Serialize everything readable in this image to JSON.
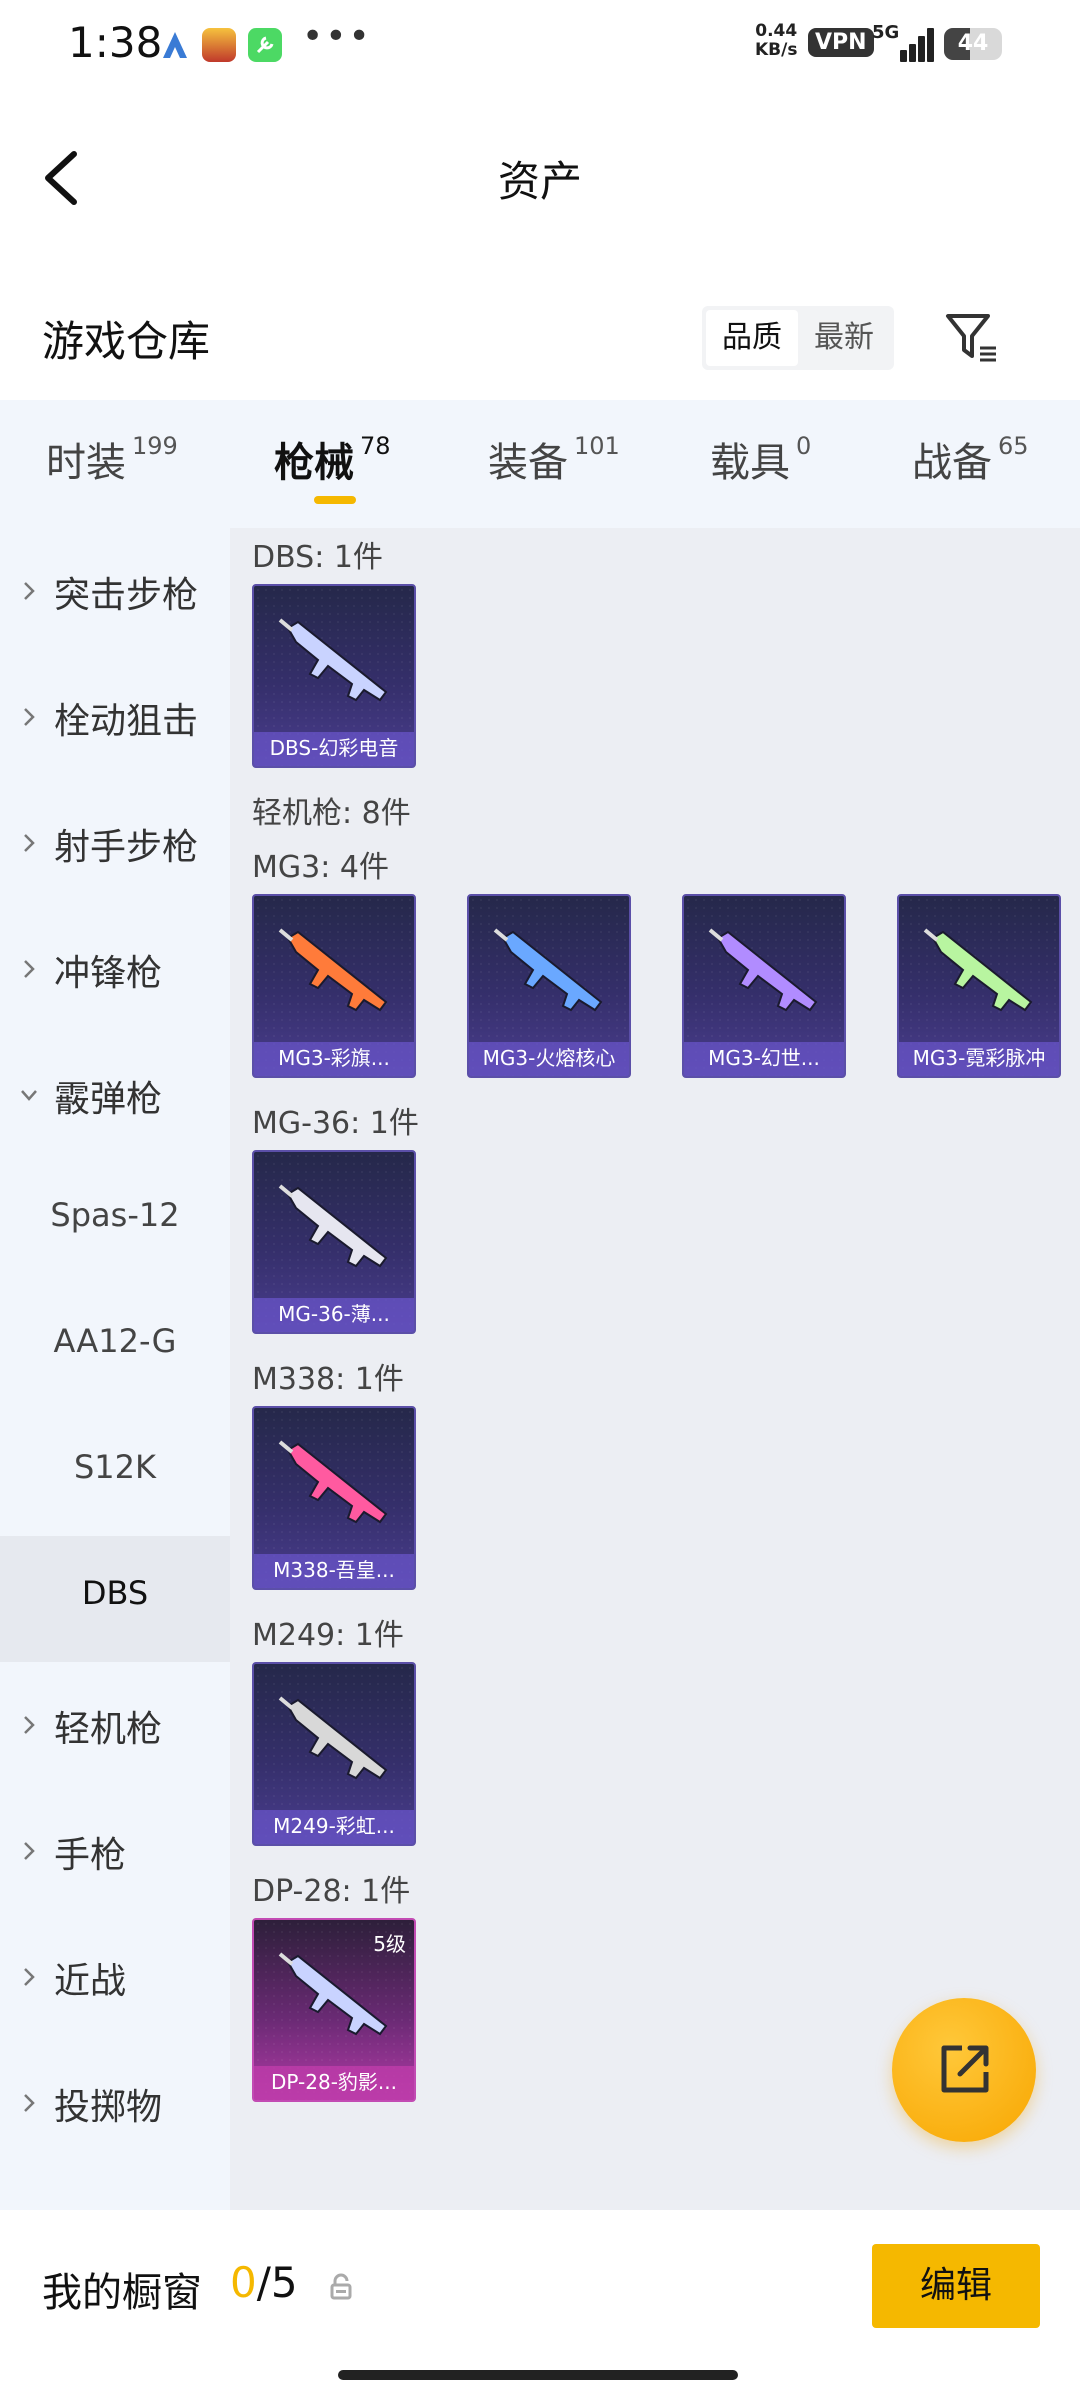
{
  "status_bar": {
    "time": "1:38",
    "speed_value": "0.44",
    "speed_unit": "KB/s",
    "vpn": "VPN",
    "network": "5G",
    "battery": "44",
    "battery_level": 0.44
  },
  "header": {
    "title": "资产"
  },
  "warehouse": {
    "title": "游戏仓库",
    "sort_options": [
      "品质",
      "最新"
    ],
    "active_sort": "品质"
  },
  "tabs": [
    {
      "label": "时装",
      "count": "199"
    },
    {
      "label": "枪械",
      "count": "78"
    },
    {
      "label": "装备",
      "count": "101"
    },
    {
      "label": "载具",
      "count": "0"
    },
    {
      "label": "战备",
      "count": "65"
    }
  ],
  "active_tab": "枪械",
  "sidebar": {
    "items": [
      {
        "label": "突击步枪",
        "type": "category",
        "expanded": false
      },
      {
        "label": "栓动狙击",
        "type": "category",
        "expanded": false
      },
      {
        "label": "射手步枪",
        "type": "category",
        "expanded": false
      },
      {
        "label": "冲锋枪",
        "type": "category",
        "expanded": false
      },
      {
        "label": "霰弹枪",
        "type": "category",
        "expanded": true
      },
      {
        "label": "Spas-12",
        "type": "sub"
      },
      {
        "label": "AA12-G",
        "type": "sub"
      },
      {
        "label": "S12K",
        "type": "sub"
      },
      {
        "label": "DBS",
        "type": "sub",
        "selected": true
      },
      {
        "label": "轻机枪",
        "type": "category",
        "expanded": false
      },
      {
        "label": "手枪",
        "type": "category",
        "expanded": false
      },
      {
        "label": "近战",
        "type": "category",
        "expanded": false
      },
      {
        "label": "投掷物",
        "type": "category",
        "expanded": false
      }
    ]
  },
  "content": {
    "sections": [
      {
        "title": "DBS: 1件",
        "items": [
          {
            "name": "DBS-幻彩电音"
          }
        ]
      },
      {
        "title": "轻机枪: 8件",
        "items": []
      },
      {
        "title": "MG3: 4件",
        "items": [
          {
            "name": "MG3-彩旗..."
          },
          {
            "name": "MG3-火熔核心"
          },
          {
            "name": "MG3-幻世..."
          },
          {
            "name": "MG3-霓彩脉冲"
          }
        ]
      },
      {
        "title": "MG-36: 1件",
        "items": [
          {
            "name": "MG-36-薄..."
          }
        ]
      },
      {
        "title": "M338: 1件",
        "items": [
          {
            "name": "M338-吾皇..."
          }
        ]
      },
      {
        "title": "M249: 1件",
        "items": [
          {
            "name": "M249-彩虹..."
          }
        ]
      },
      {
        "title": "DP-28: 1件",
        "items": [
          {
            "name": "DP-28-豹影...",
            "level": "5级",
            "rarity": "pink"
          }
        ]
      }
    ]
  },
  "showcase": {
    "title": "我的橱窗",
    "current": "0",
    "total": "/5",
    "edit_label": "编辑"
  },
  "colors": {
    "accent": "#f5b800",
    "tab_bg": "#f2f6fc",
    "content_bg": "#eceef3",
    "card_purple": "#352f6b",
    "card_pink": "#b13aa6"
  }
}
